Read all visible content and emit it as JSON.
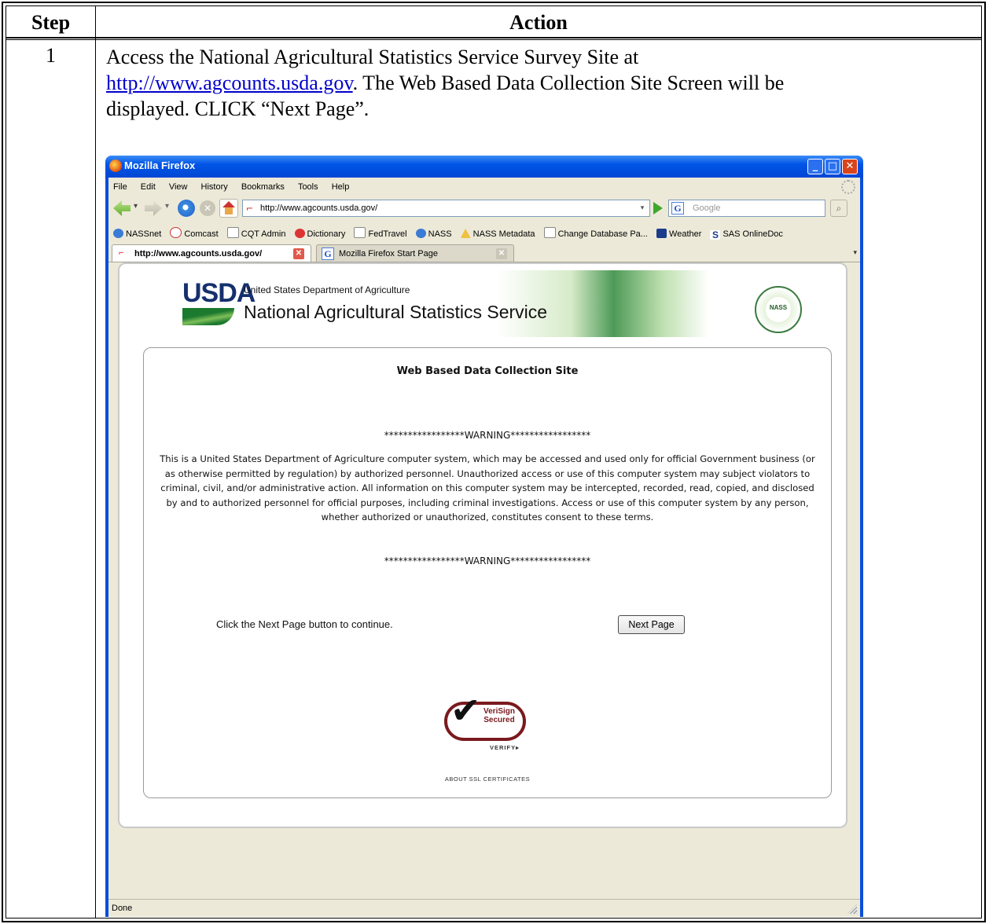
{
  "table": {
    "header_step": "Step",
    "header_action": "Action",
    "row_step": "1",
    "instr_line1": "Access the National Agricultural Statistics Service Survey Site at",
    "instr_link": "http://www.agcounts.usda.gov",
    "instr_line2": ".  The Web Based Data Collection Site Screen will be",
    "instr_line3": "displayed.  CLICK “Next Page”."
  },
  "browser": {
    "title": "Mozilla Firefox",
    "menu": [
      "File",
      "Edit",
      "View",
      "History",
      "Bookmarks",
      "Tools",
      "Help"
    ],
    "url": "http://www.agcounts.usda.gov/",
    "search_placeholder": "Google",
    "bookmarks": [
      "NASSnet",
      "Comcast",
      "CQT Admin",
      "Dictionary",
      "FedTravel",
      "NASS",
      "NASS Metadata",
      "Change Database Pa...",
      "Weather",
      "SAS OnlineDoc"
    ],
    "tabs": [
      "http://www.agcounts.usda.gov/",
      "Mozilla Firefox Start Page"
    ],
    "status": "Done"
  },
  "page": {
    "usda_logo": "USDA",
    "agency_small": "United States Department of Agriculture",
    "agency_big": "National Agricultural Statistics Service",
    "seal_text": "AGRICULTURE COUNTS",
    "seal_center": "NASS",
    "site_title": "Web Based Data Collection Site",
    "warning_banner": "*****************WARNING*****************",
    "warning_body": "This is a United States Department of Agriculture computer system, which may be accessed and used only for official Government business (or as otherwise permitted by regulation) by authorized personnel. Unauthorized access or use of this computer system may subject violators to criminal, civil, and/or administrative action. All information on this computer system may be intercepted, recorded, read, copied, and disclosed by and to authorized personnel for official purposes, including criminal investigations. Access or use of this computer system by any person, whether authorized or unauthorized, constitutes consent to these terms.",
    "click_instruction": "Click the Next Page button to continue.",
    "next_button": "Next Page",
    "verisign_line1": "VeriSign",
    "verisign_line2": "Secured",
    "verisign_verify": "VERIFY▸",
    "ssl_link": "ABOUT SSL CERTIFICATES"
  },
  "colors": {
    "link": "#0000cc",
    "titlebar": "#0055e5",
    "usda_blue": "#16306e",
    "verisign_red": "#7a1a1e"
  }
}
